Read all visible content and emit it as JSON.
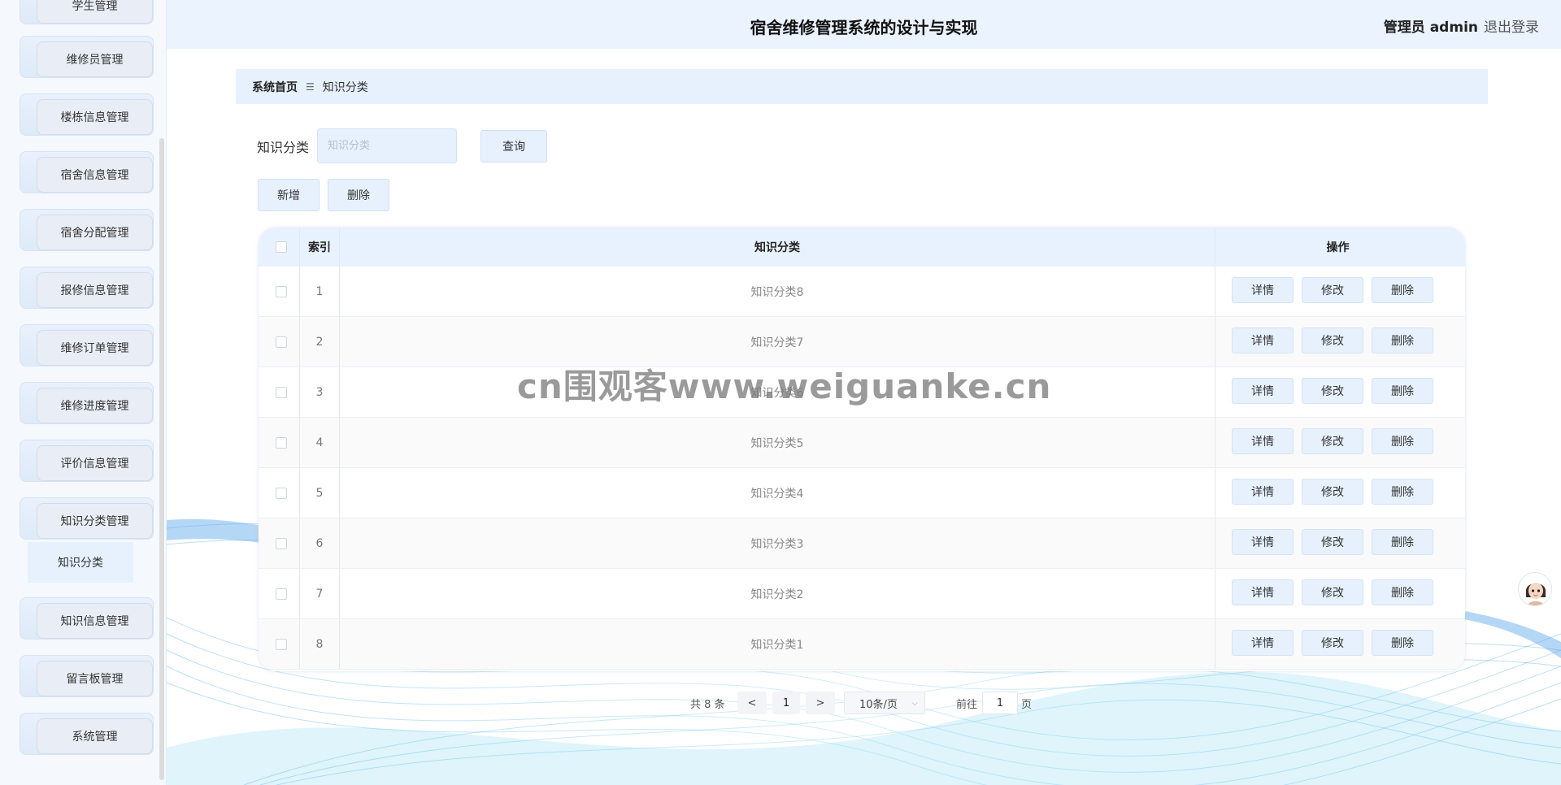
{
  "header": {
    "title": "宿舍维修管理系统的设计与实现",
    "admin": "管理员 admin",
    "logout": "退出登录"
  },
  "sidebar": {
    "items": [
      {
        "label": "学生管理"
      },
      {
        "label": "维修员管理"
      },
      {
        "label": "楼栋信息管理"
      },
      {
        "label": "宿舍信息管理"
      },
      {
        "label": "宿舍分配管理"
      },
      {
        "label": "报修信息管理"
      },
      {
        "label": "维修订单管理"
      },
      {
        "label": "维修进度管理"
      },
      {
        "label": "评价信息管理"
      },
      {
        "label": "知识分类管理"
      },
      {
        "label": "知识信息管理"
      },
      {
        "label": "留言板管理"
      },
      {
        "label": "系统管理"
      }
    ],
    "sub_item": "知识分类"
  },
  "breadcrumb": {
    "home": "系统首页",
    "current": "知识分类"
  },
  "search": {
    "label": "知识分类",
    "placeholder": "知识分类",
    "button": "查询"
  },
  "toolbar": {
    "add": "新增",
    "delete": "删除"
  },
  "table": {
    "headers": {
      "index": "索引",
      "name": "知识分类",
      "ops": "操作"
    },
    "rows": [
      {
        "index": "1",
        "name": "知识分类8"
      },
      {
        "index": "2",
        "name": "知识分类7"
      },
      {
        "index": "3",
        "name": "知识分类6"
      },
      {
        "index": "4",
        "name": "知识分类5"
      },
      {
        "index": "5",
        "name": "知识分类4"
      },
      {
        "index": "6",
        "name": "知识分类3"
      },
      {
        "index": "7",
        "name": "知识分类2"
      },
      {
        "index": "8",
        "name": "知识分类1"
      }
    ],
    "row_actions": {
      "detail": "详情",
      "edit": "修改",
      "delete": "删除"
    }
  },
  "pagination": {
    "total": "共 8 条",
    "prev": "<",
    "page": "1",
    "next": ">",
    "page_size": "10条/页",
    "goto_label": "前往",
    "goto_value": "1",
    "goto_suffix": "页"
  },
  "watermark": "cn围观客www.weiguanke.cn",
  "icons": {
    "dropdown": "chevron-down-icon",
    "avatar": "assistant-avatar"
  }
}
